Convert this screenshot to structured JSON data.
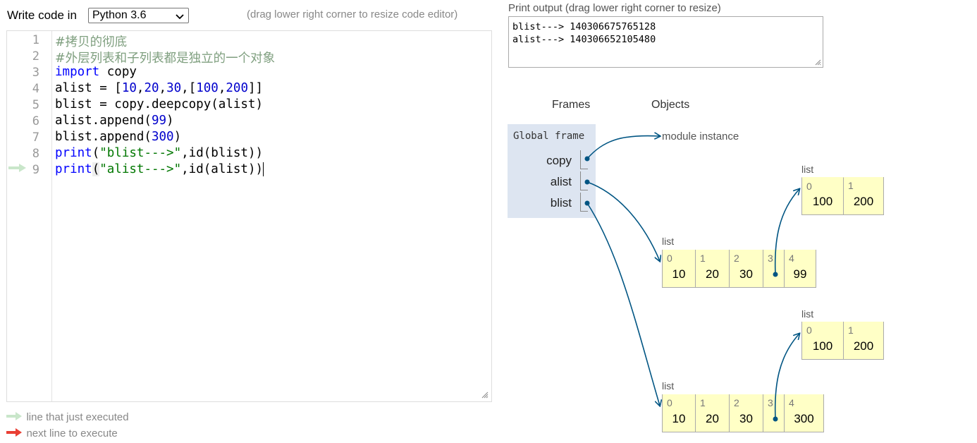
{
  "header": {
    "write_label": "Write code in",
    "language": "Python 3.6",
    "drag_hint": "(drag lower right corner to resize code editor)"
  },
  "editor": {
    "lines": [
      {
        "num": "1"
      },
      {
        "num": "2"
      },
      {
        "num": "3"
      },
      {
        "num": "4"
      },
      {
        "num": "5"
      },
      {
        "num": "6"
      },
      {
        "num": "7"
      },
      {
        "num": "8"
      },
      {
        "num": "9"
      }
    ],
    "code": {
      "l1_comment": "#拷贝的彻底",
      "l2_comment": "#外层列表和子列表都是独立的一个对象",
      "l3_kw": "import",
      "l3_rest": " copy",
      "l4_a": "alist = [",
      "l4_n1": "10",
      "l4_c1": ",",
      "l4_n2": "20",
      "l4_c2": ",",
      "l4_n3": "30",
      "l4_c3": ",[",
      "l4_n4": "100",
      "l4_c4": ",",
      "l4_n5": "200",
      "l4_end": "]]",
      "l5": "blist = copy.deepcopy(alist)",
      "l6_a": "alist.append(",
      "l6_n": "99",
      "l6_end": ")",
      "l7_a": "blist.append(",
      "l7_n": "300",
      "l7_end": ")",
      "l8_kw": "print",
      "l8_p": "(",
      "l8_str": "\"blist--->\"",
      "l8_rest": ",id(blist))",
      "l9_kw": "print",
      "l9_p": "(",
      "l9_str": "\"alist--->\"",
      "l9_rest": ",id(alist))"
    }
  },
  "legend": {
    "just_executed": "line that just executed",
    "next_line": "next line to execute"
  },
  "print_output": {
    "label": "Print output (drag lower right corner to resize)",
    "lines": [
      "blist---> 140306675765128",
      "alist---> 140306652105480"
    ]
  },
  "viz": {
    "frames_header": "Frames",
    "objects_header": "Objects",
    "global_frame": "Global frame",
    "vars": [
      "copy",
      "alist",
      "blist"
    ],
    "module_instance": "module instance",
    "list_label": "list",
    "list_a_inner": {
      "indices": [
        "0",
        "1"
      ],
      "values": [
        "100",
        "200"
      ]
    },
    "list_a": {
      "indices": [
        "0",
        "1",
        "2",
        "3",
        "4"
      ],
      "values": [
        "10",
        "20",
        "30",
        "",
        "99"
      ]
    },
    "list_b_inner": {
      "indices": [
        "0",
        "1"
      ],
      "values": [
        "100",
        "200"
      ]
    },
    "list_b": {
      "indices": [
        "0",
        "1",
        "2",
        "3",
        "4"
      ],
      "values": [
        "10",
        "20",
        "30",
        "",
        "300"
      ]
    }
  },
  "colors": {
    "arrow": "#005583",
    "just_executed_arrow": "#c9e6ca",
    "next_line_arrow": "#e93f34",
    "list_cell": "#ffffc6",
    "frame_bg": "#dde5f1"
  }
}
